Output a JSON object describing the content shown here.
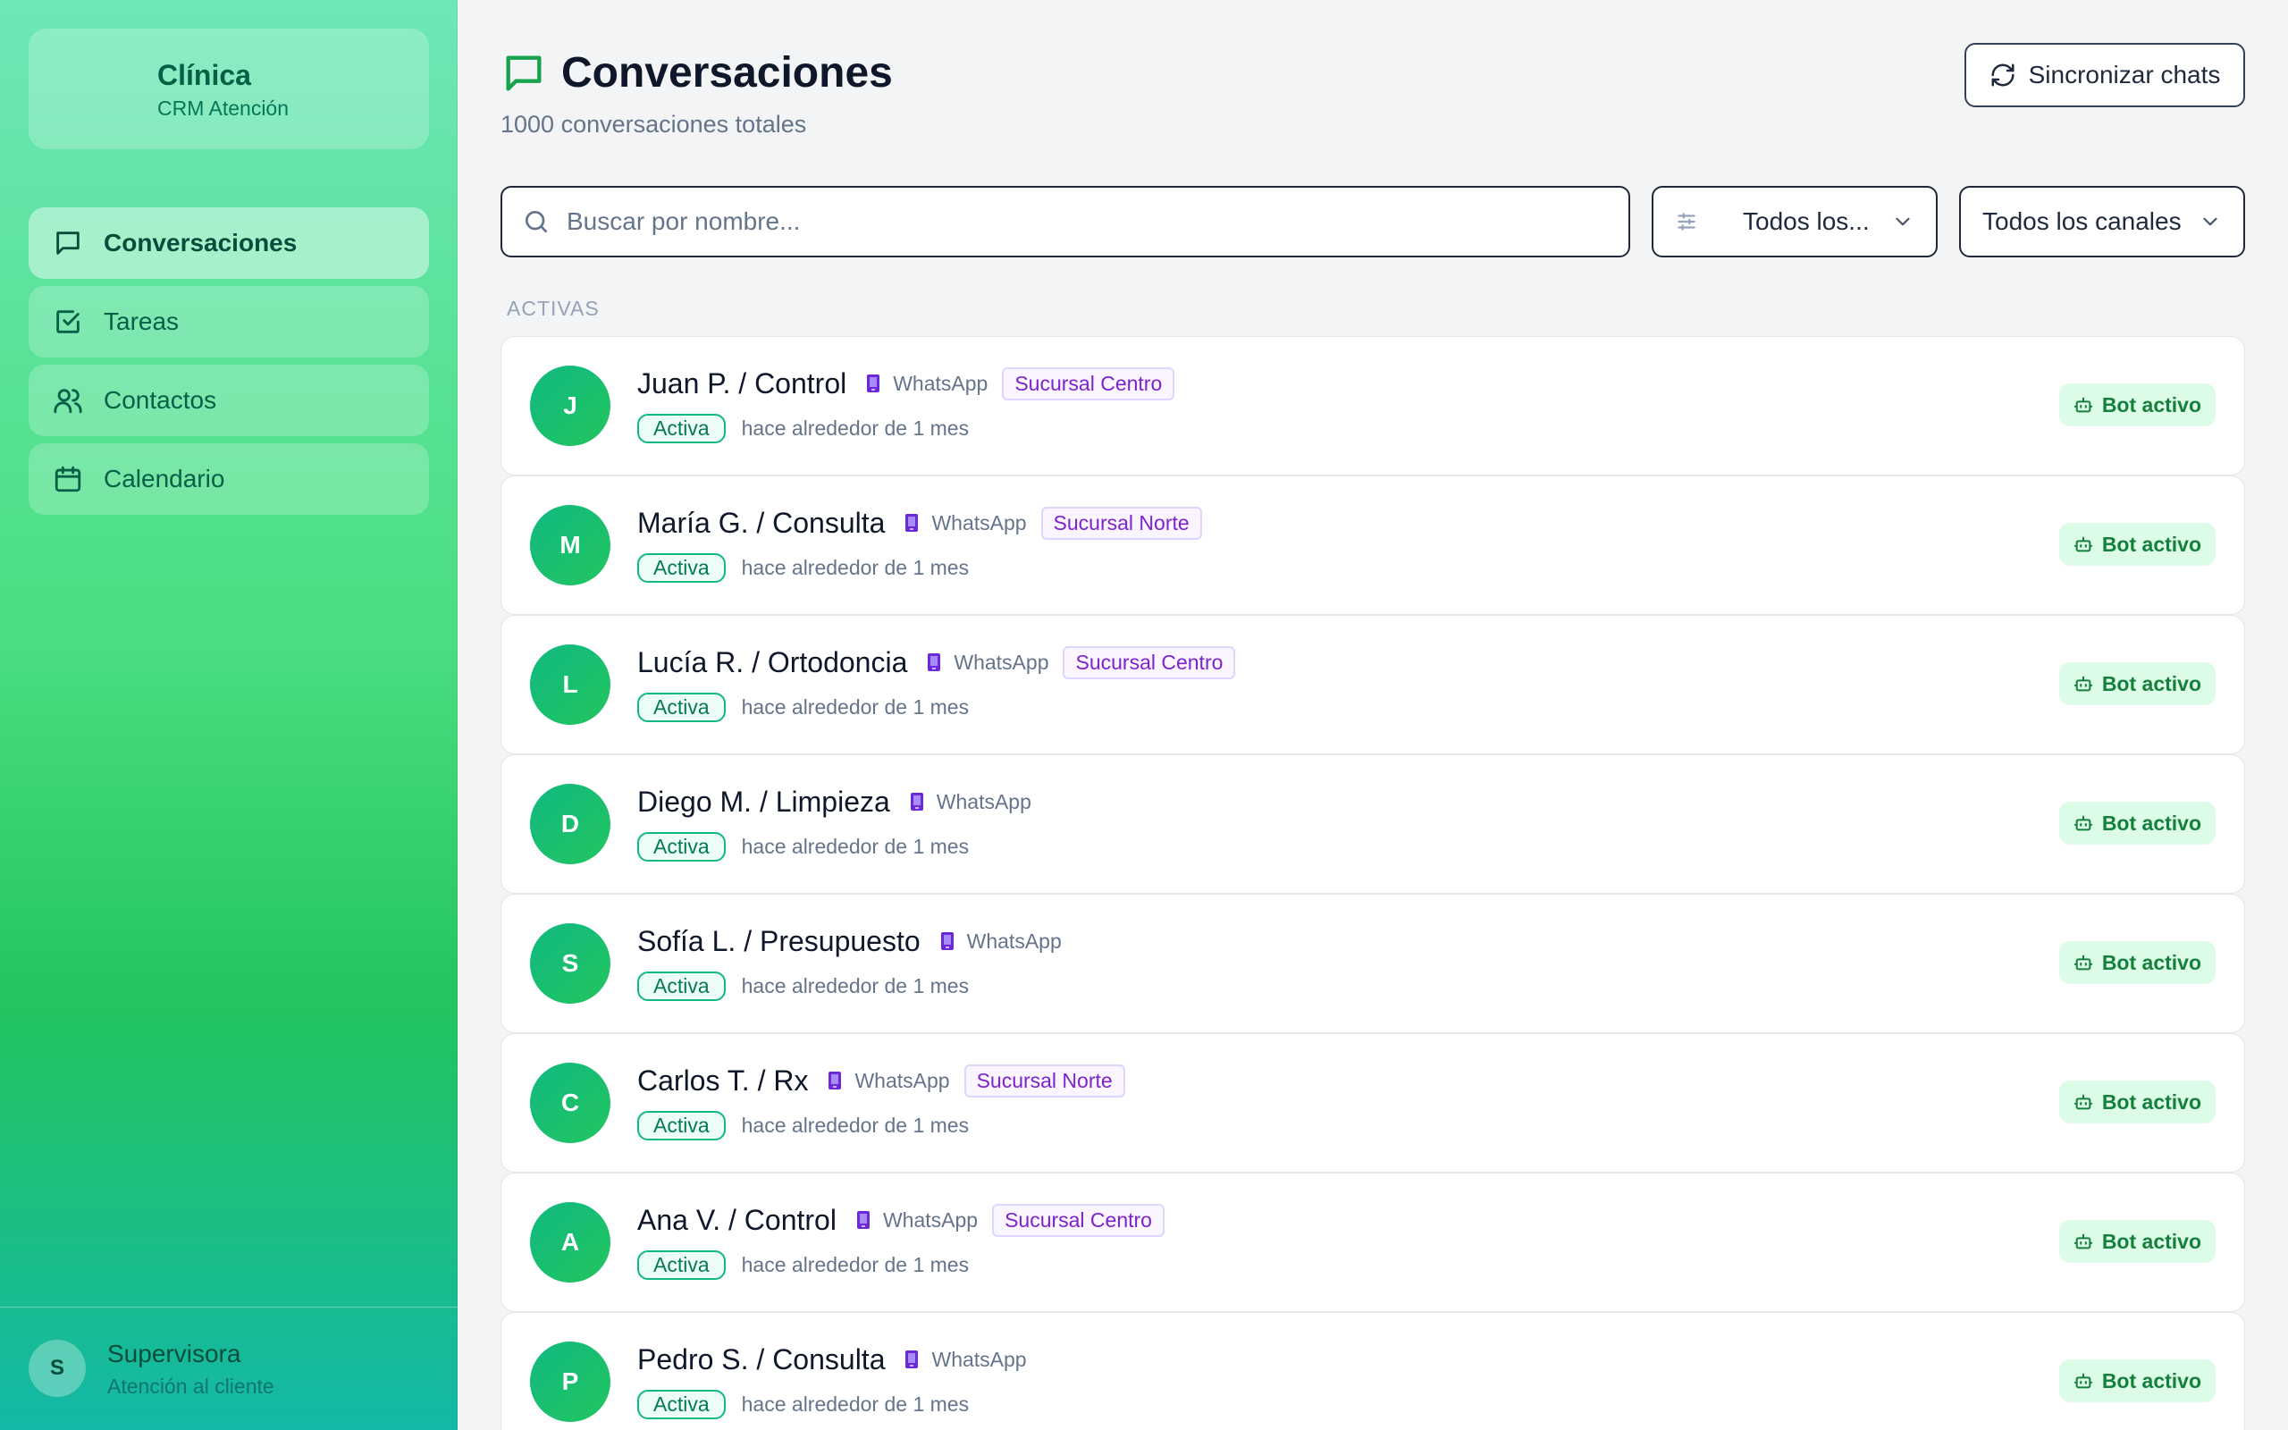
{
  "brand": {
    "title": "Clínica",
    "subtitle": "CRM Atención"
  },
  "nav": [
    {
      "label": "Conversaciones",
      "icon": "message-square-icon",
      "active": true
    },
    {
      "label": "Tareas",
      "icon": "check-square-icon",
      "active": false
    },
    {
      "label": "Contactos",
      "icon": "users-icon",
      "active": false
    },
    {
      "label": "Calendario",
      "icon": "calendar-icon",
      "active": false
    }
  ],
  "user": {
    "initial": "S",
    "name": "Supervisora",
    "role": "Atención al cliente"
  },
  "header": {
    "title": "Conversaciones",
    "subtitle": "1000 conversaciones totales",
    "sync_label": "Sincronizar chats"
  },
  "filters": {
    "search_placeholder": "Buscar por nombre...",
    "status_value": "Todos los...",
    "channel_value": "Todos los canales"
  },
  "section_label": "ACTIVAS",
  "conversations": [
    {
      "initial": "J",
      "name": "Juan P. / Control",
      "channel": "WhatsApp",
      "branch": "Sucursal Centro",
      "status": "Activa",
      "time": "hace alrededor de 1 mes",
      "bot": "Bot activo"
    },
    {
      "initial": "M",
      "name": "María G. / Consulta",
      "channel": "WhatsApp",
      "branch": "Sucursal Norte",
      "status": "Activa",
      "time": "hace alrededor de 1 mes",
      "bot": "Bot activo"
    },
    {
      "initial": "L",
      "name": "Lucía R. / Ortodoncia",
      "channel": "WhatsApp",
      "branch": "Sucursal Centro",
      "status": "Activa",
      "time": "hace alrededor de 1 mes",
      "bot": "Bot activo"
    },
    {
      "initial": "D",
      "name": "Diego M. / Limpieza",
      "channel": "WhatsApp",
      "branch": "",
      "status": "Activa",
      "time": "hace alrededor de 1 mes",
      "bot": "Bot activo"
    },
    {
      "initial": "S",
      "name": "Sofía L. / Presupuesto",
      "channel": "WhatsApp",
      "branch": "",
      "status": "Activa",
      "time": "hace alrededor de 1 mes",
      "bot": "Bot activo"
    },
    {
      "initial": "C",
      "name": "Carlos T. / Rx",
      "channel": "WhatsApp",
      "branch": "Sucursal Norte",
      "status": "Activa",
      "time": "hace alrededor de 1 mes",
      "bot": "Bot activo"
    },
    {
      "initial": "A",
      "name": "Ana V. / Control",
      "channel": "WhatsApp",
      "branch": "Sucursal Centro",
      "status": "Activa",
      "time": "hace alrededor de 1 mes",
      "bot": "Bot activo"
    },
    {
      "initial": "P",
      "name": "Pedro S. / Consulta",
      "channel": "WhatsApp",
      "branch": "",
      "status": "Activa",
      "time": "hace alrededor de 1 mes",
      "bot": "Bot activo"
    }
  ]
}
